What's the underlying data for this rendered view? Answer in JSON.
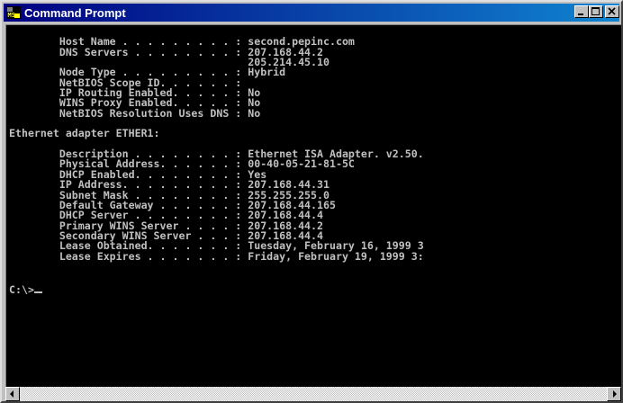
{
  "window": {
    "title": "Command Prompt",
    "app_icon": "ms-dos-icon",
    "controls": [
      "minimize-icon",
      "maximize-icon",
      "close-icon"
    ]
  },
  "console": {
    "lines": [
      "",
      "        Host Name . . . . . . . . . : second.pepinc.com",
      "        DNS Servers . . . . . . . . : 207.168.44.2",
      "                                      205.214.45.10",
      "        Node Type . . . . . . . . . : Hybrid",
      "        NetBIOS Scope ID. . . . . . :",
      "        IP Routing Enabled. . . . . : No",
      "        WINS Proxy Enabled. . . . . : No",
      "        NetBIOS Resolution Uses DNS : No",
      "",
      "Ethernet adapter ETHER1:",
      "",
      "        Description . . . . . . . . : Ethernet ISA Adapter. v2.50.",
      "        Physical Address. . . . . . : 00-40-05-21-81-5C",
      "        DHCP Enabled. . . . . . . . : Yes",
      "        IP Address. . . . . . . . . : 207.168.44.31",
      "        Subnet Mask . . . . . . . . : 255.255.255.0",
      "        Default Gateway . . . . . . : 207.168.44.165",
      "        DHCP Server . . . . . . . . : 207.168.44.4",
      "        Primary WINS Server . . . . : 207.168.44.2",
      "        Secondary WINS Server . . . : 207.168.44.4",
      "        Lease Obtained. . . . . . . : Tuesday, February 16, 1999 3",
      "        Lease Expires . . . . . . . : Friday, February 19, 1999 3:",
      "",
      ""
    ],
    "prompt": "C:\\>",
    "text_color": "#c0c0c0",
    "background_color": "#000000"
  },
  "colors": {
    "titlebar_start": "#000080",
    "titlebar_end": "#1084d0",
    "chrome": "#c0c0c0"
  },
  "scrollbar": {
    "left_icon": "scroll-left-arrow-icon",
    "right_icon": "scroll-right-arrow-icon"
  }
}
